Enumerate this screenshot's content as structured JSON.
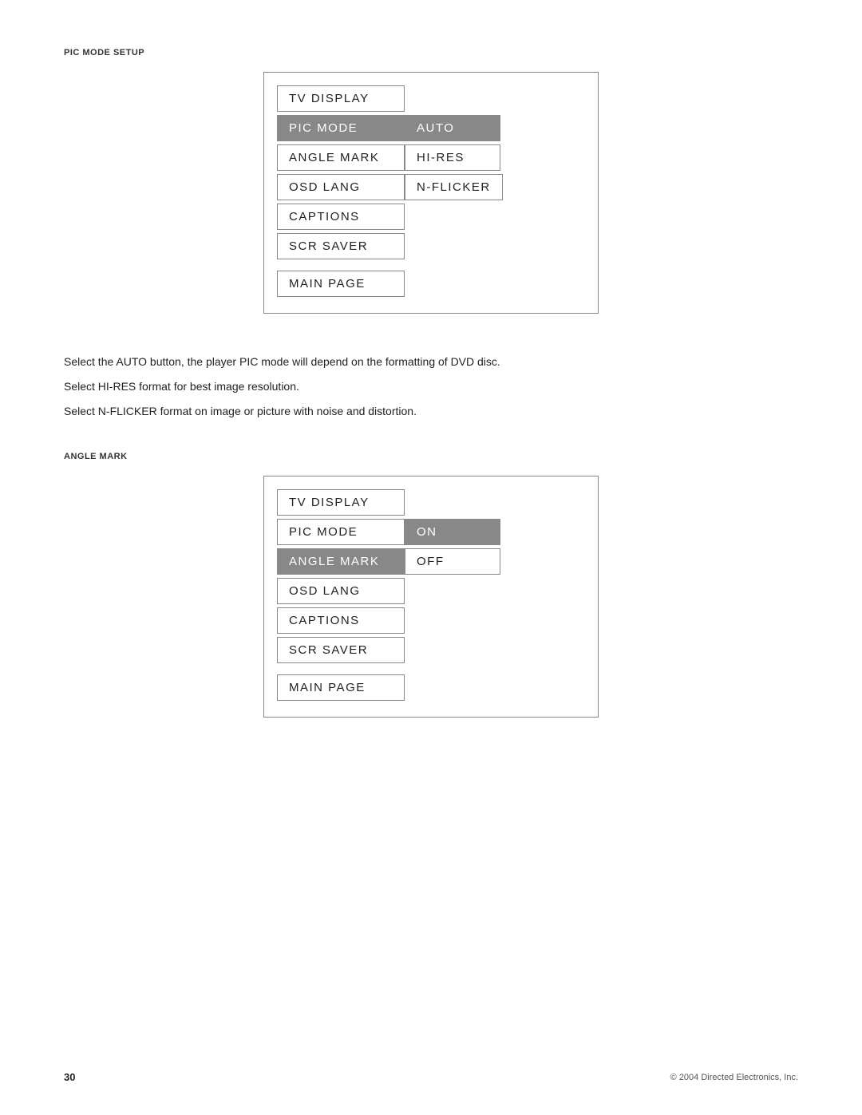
{
  "page": {
    "title": "PIC MODE SETUP",
    "angle_mark_label": "ANGLE MARK",
    "page_number": "30",
    "copyright": "© 2004 Directed Electronics, Inc."
  },
  "menu1": {
    "label": "PIC MODE SETUP",
    "rows": [
      {
        "left": "TV DISPLAY",
        "right": null,
        "left_highlighted": false,
        "right_highlighted": false
      },
      {
        "left": "PIC MODE",
        "right": "AUTO",
        "left_highlighted": true,
        "right_highlighted": true
      },
      {
        "left": "ANGLE MARK",
        "right": "HI-RES",
        "left_highlighted": false,
        "right_highlighted": false
      },
      {
        "left": "OSD LANG",
        "right": "N-FLICKER",
        "left_highlighted": false,
        "right_highlighted": false
      },
      {
        "left": "CAPTIONS",
        "right": null,
        "left_highlighted": false,
        "right_highlighted": false
      },
      {
        "left": "SCR SAVER",
        "right": null,
        "left_highlighted": false,
        "right_highlighted": false
      }
    ],
    "main_page": "MAIN PAGE"
  },
  "descriptions": [
    "Select the AUTO button, the player PIC mode will depend on the formatting of DVD disc.",
    "Select HI-RES format for best image resolution.",
    "Select N-FLICKER format on image or picture with noise and distortion."
  ],
  "menu2": {
    "label": "ANGLE MARK",
    "rows": [
      {
        "left": "TV DISPLAY",
        "right": null,
        "left_highlighted": false,
        "right_highlighted": false
      },
      {
        "left": "PIC MODE",
        "right": "ON",
        "left_highlighted": false,
        "right_highlighted": true
      },
      {
        "left": "ANGLE MARK",
        "right": "OFF",
        "left_highlighted": true,
        "right_highlighted": false
      },
      {
        "left": "OSD LANG",
        "right": null,
        "left_highlighted": false,
        "right_highlighted": false
      },
      {
        "left": "CAPTIONS",
        "right": null,
        "left_highlighted": false,
        "right_highlighted": false
      },
      {
        "left": "SCR SAVER",
        "right": null,
        "left_highlighted": false,
        "right_highlighted": false
      }
    ],
    "main_page": "MAIN PAGE"
  }
}
